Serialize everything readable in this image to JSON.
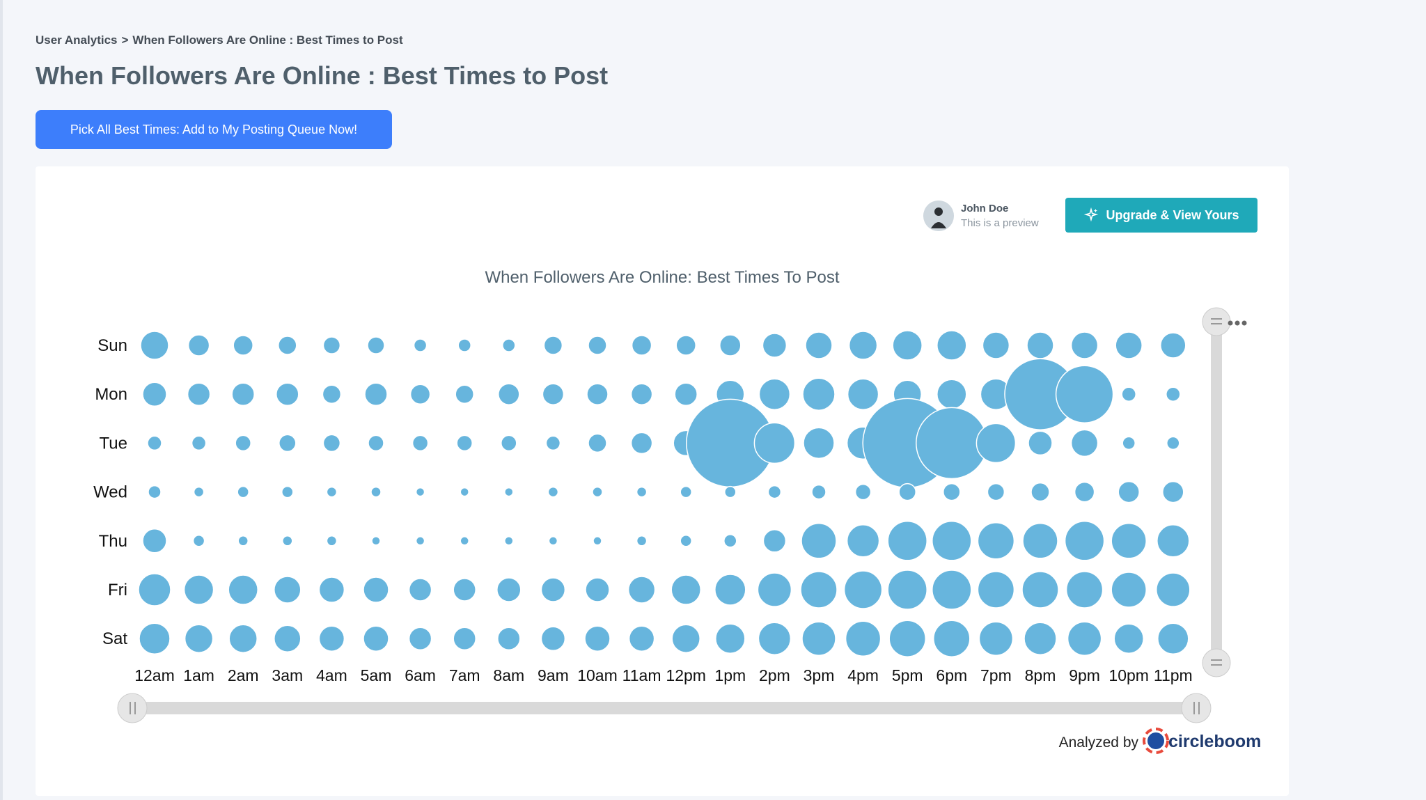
{
  "breadcrumb": {
    "root": "User Analytics",
    "separator": ">",
    "current": "When Followers Are Online : Best Times to Post"
  },
  "page_title": "When Followers Are Online : Best Times to Post",
  "primary_button": "Pick All Best Times: Add to My Posting Queue Now!",
  "preview_user": {
    "name": "John Doe",
    "subtitle": "This is a preview",
    "avatar_icon": "user-avatar-icon"
  },
  "upgrade_button": {
    "label": "Upgrade & View Yours",
    "icon": "sparkle-icon"
  },
  "footer": {
    "analyzed_by": "Analyzed by",
    "brand": "circleboom"
  },
  "colors": {
    "primary": "#3d7efb",
    "teal": "#1fa9b9",
    "bubble": "#67b5dd",
    "title_text": "#4f5f6b"
  },
  "chart_data": {
    "type": "bubble",
    "title": "When Followers Are Online: Best Times To Post",
    "y_categories": [
      "Sun",
      "Mon",
      "Tue",
      "Wed",
      "Thu",
      "Fri",
      "Sat"
    ],
    "x_categories": [
      "12am",
      "1am",
      "2am",
      "3am",
      "4am",
      "5am",
      "6am",
      "7am",
      "8am",
      "9am",
      "10am",
      "11am",
      "12pm",
      "1pm",
      "2pm",
      "3pm",
      "4pm",
      "5pm",
      "6pm",
      "7pm",
      "8pm",
      "9pm",
      "10pm",
      "11pm"
    ],
    "relative_sizes": [
      [
        20,
        15,
        14,
        13,
        12,
        12,
        9,
        9,
        9,
        13,
        13,
        14,
        14,
        15,
        17,
        19,
        20,
        21,
        21,
        19,
        19,
        19,
        19,
        18
      ],
      [
        17,
        16,
        16,
        16,
        13,
        16,
        14,
        13,
        15,
        15,
        15,
        15,
        16,
        20,
        22,
        23,
        22,
        20,
        21,
        22,
        51,
        41,
        10,
        10
      ],
      [
        10,
        10,
        11,
        12,
        12,
        11,
        11,
        11,
        11,
        10,
        13,
        15,
        18,
        63,
        29,
        22,
        23,
        64,
        51,
        28,
        17,
        19,
        9,
        9
      ],
      [
        9,
        7,
        8,
        8,
        7,
        7,
        6,
        6,
        6,
        7,
        7,
        7,
        8,
        8,
        9,
        10,
        11,
        12,
        12,
        12,
        13,
        14,
        15,
        15
      ],
      [
        17,
        8,
        7,
        7,
        7,
        6,
        6,
        6,
        6,
        6,
        6,
        7,
        8,
        9,
        16,
        25,
        23,
        28,
        28,
        26,
        25,
        28,
        25,
        23
      ],
      [
        23,
        21,
        21,
        19,
        18,
        18,
        16,
        16,
        17,
        17,
        17,
        19,
        21,
        22,
        24,
        26,
        27,
        28,
        28,
        26,
        26,
        26,
        25,
        24
      ],
      [
        22,
        20,
        20,
        19,
        18,
        18,
        16,
        16,
        16,
        17,
        18,
        18,
        20,
        21,
        23,
        24,
        25,
        26,
        26,
        24,
        23,
        24,
        21,
        22
      ]
    ],
    "legend": "none",
    "grid": false,
    "navigator": true
  }
}
